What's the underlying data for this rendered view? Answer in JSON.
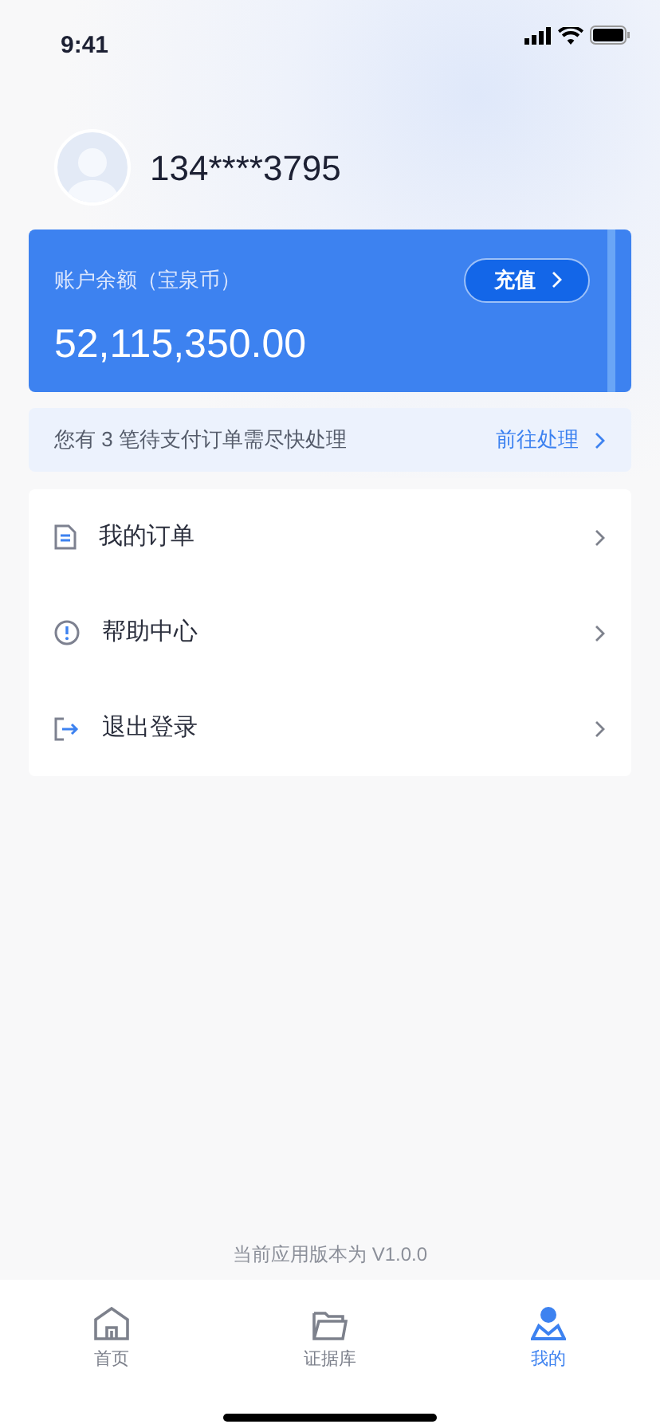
{
  "status_bar": {
    "time": "9:41"
  },
  "profile": {
    "phone": "134****3795"
  },
  "balance_card": {
    "label": "账户余额（宝泉币）",
    "amount": "52,115,350.00",
    "button": "充值"
  },
  "notice": {
    "text": "您有 3 笔待支付订单需尽快处理",
    "action": "前往处理"
  },
  "menu": [
    {
      "kind": "orders",
      "label": "我的订单"
    },
    {
      "kind": "help",
      "label": "帮助中心"
    },
    {
      "kind": "logout",
      "label": "退出登录"
    }
  ],
  "version": "当前应用版本为 V1.0.0",
  "tabs": [
    {
      "kind": "home",
      "label": "首页",
      "selected": false
    },
    {
      "kind": "folder",
      "label": "证据库",
      "selected": false
    },
    {
      "kind": "profile",
      "label": "我的",
      "selected": true
    }
  ]
}
